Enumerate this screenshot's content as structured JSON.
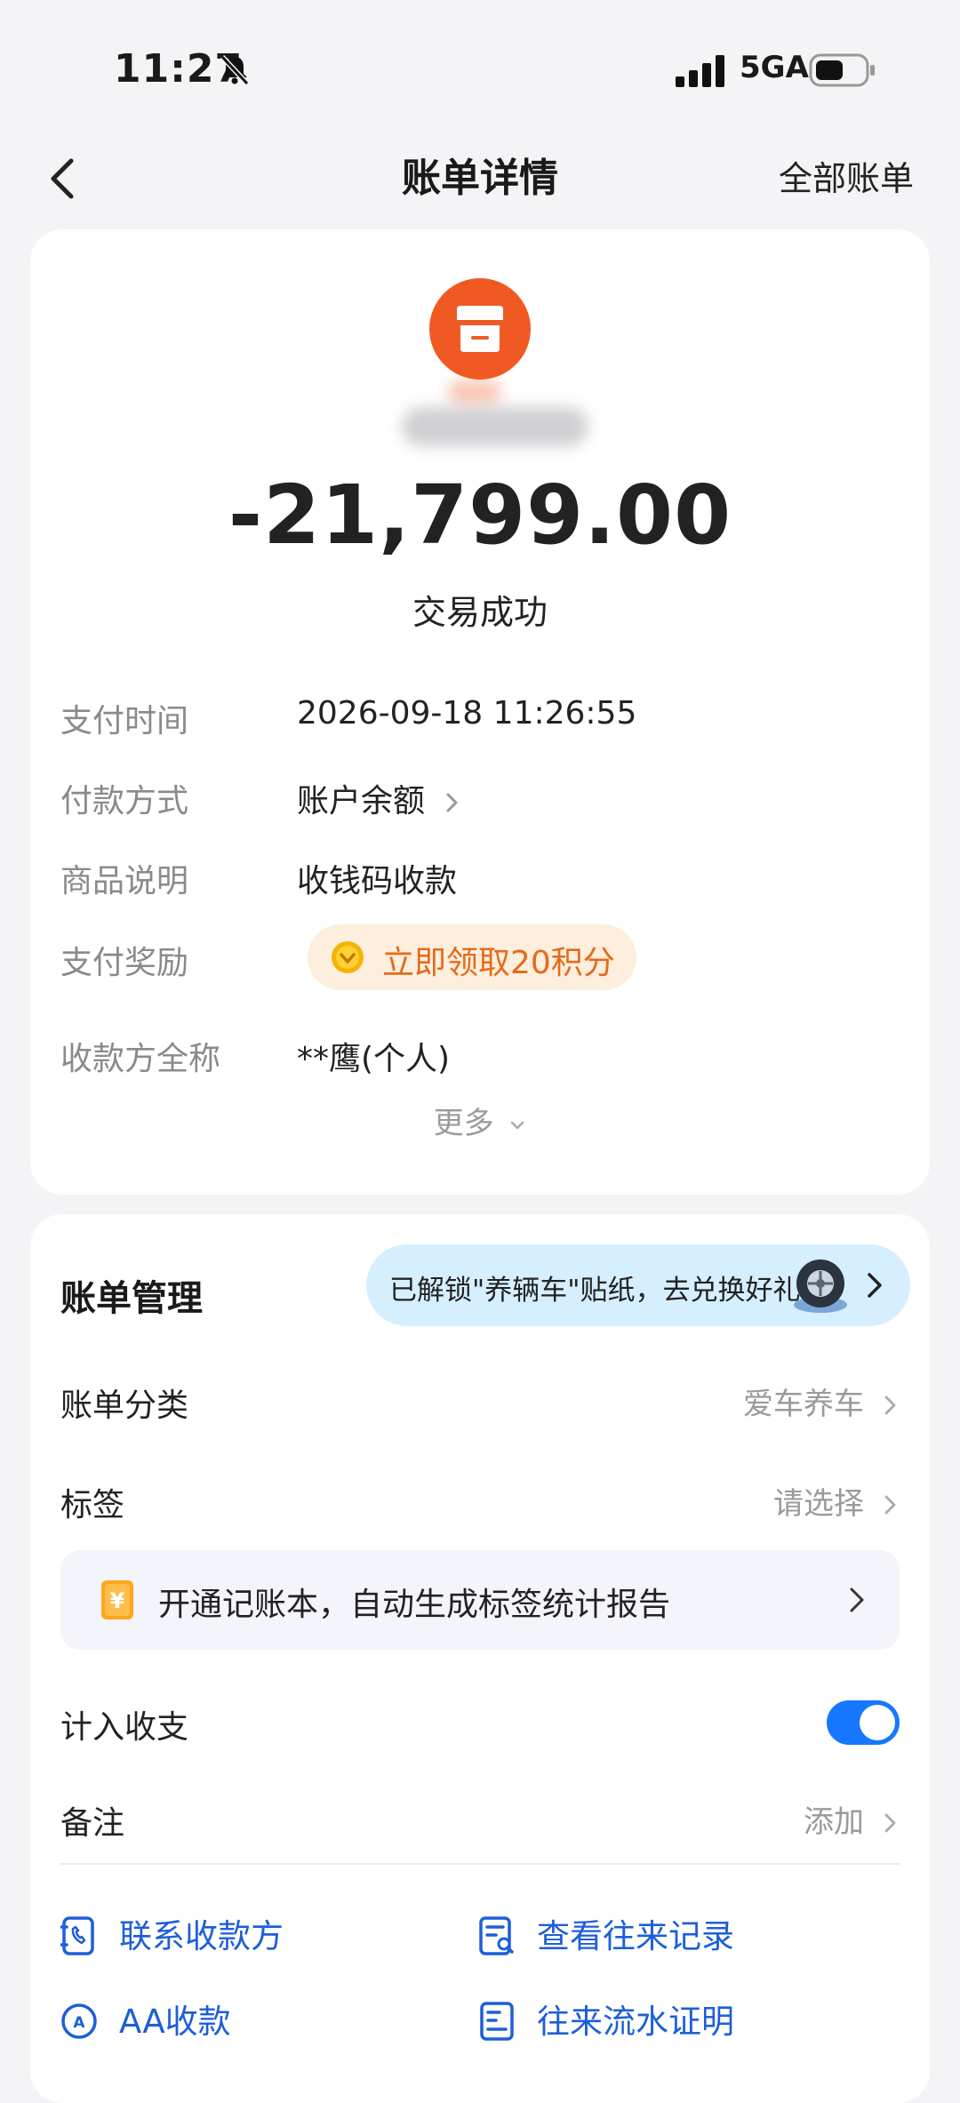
{
  "status_bar": {
    "time": "11:27",
    "network": "5GA"
  },
  "nav": {
    "title": "账单详情",
    "all_bills": "全部账单"
  },
  "transaction": {
    "amount": "-21,799.00",
    "status": "交易成功",
    "details": [
      {
        "label": "支付时间",
        "value": "2026-09-18 11:26:55"
      },
      {
        "label": "付款方式",
        "value": "账户余额"
      },
      {
        "label": "商品说明",
        "value": "收钱码收款"
      },
      {
        "label": "支付奖励",
        "value": "立即领取20积分"
      },
      {
        "label": "收款方全称",
        "value": "**鹰(个人)"
      }
    ],
    "more": "更多"
  },
  "manage": {
    "title": "账单管理",
    "sticker_banner": "已解锁\"养辆车\"贴纸，去兑换好礼",
    "category_label": "账单分类",
    "category_value": "爱车养车",
    "tag_label": "标签",
    "tag_value": "请选择",
    "ledger_banner": "开通记账本，自动生成标签统计报告",
    "include_label": "计入收支",
    "include_enabled": true,
    "note_label": "备注",
    "note_value": "添加",
    "actions": [
      {
        "label": "联系收款方",
        "icon": "phone-contact-icon"
      },
      {
        "label": "查看往来记录",
        "icon": "records-search-icon"
      },
      {
        "label": "AA收款",
        "icon": "aa-icon"
      },
      {
        "label": "往来流水证明",
        "icon": "statement-icon"
      }
    ]
  },
  "colors": {
    "accent": "#1677ff",
    "merchant": "#f05a22",
    "reward_text": "#e46b1b",
    "link_blue": "#1d5fd8"
  }
}
